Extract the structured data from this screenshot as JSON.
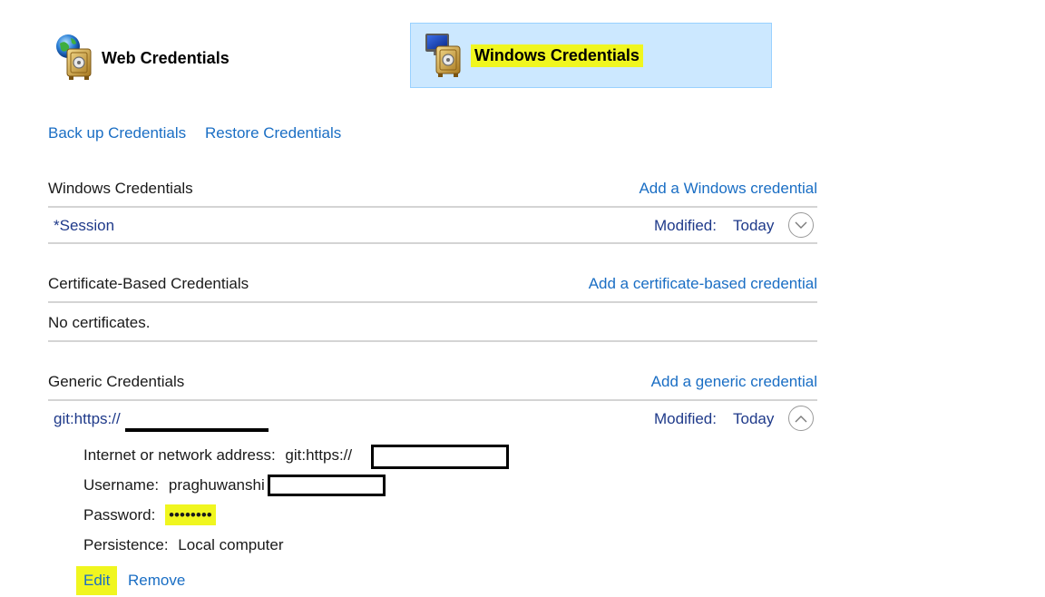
{
  "tabs": {
    "web": {
      "label": "Web Credentials"
    },
    "windows": {
      "label": "Windows Credentials"
    }
  },
  "actions": {
    "backup": "Back up Credentials",
    "restore": "Restore Credentials"
  },
  "windows_section": {
    "title": "Windows Credentials",
    "add_link": "Add a Windows credential",
    "items": [
      {
        "name": "*Session",
        "modified_label": "Modified:",
        "modified_value": "Today"
      }
    ]
  },
  "certificate_section": {
    "title": "Certificate-Based Credentials",
    "add_link": "Add a certificate-based credential",
    "empty_text": "No certificates."
  },
  "generic_section": {
    "title": "Generic Credentials",
    "add_link": "Add a generic credential",
    "item": {
      "name": "git:https://",
      "modified_label": "Modified:",
      "modified_value": "Today",
      "details": {
        "address_label": "Internet or network address:",
        "address_value": "git:https://",
        "username_label": "Username:",
        "username_value": "praghuwanshi",
        "password_label": "Password:",
        "password_value": "••••••••",
        "persistence_label": "Persistence:",
        "persistence_value": "Local computer"
      },
      "edit_label": "Edit",
      "remove_label": "Remove"
    }
  },
  "colors": {
    "link": "#1a6ec4",
    "selected_tab_bg": "#cce8ff",
    "selected_tab_border": "#99d1ff",
    "highlight": "#f0f61f"
  }
}
